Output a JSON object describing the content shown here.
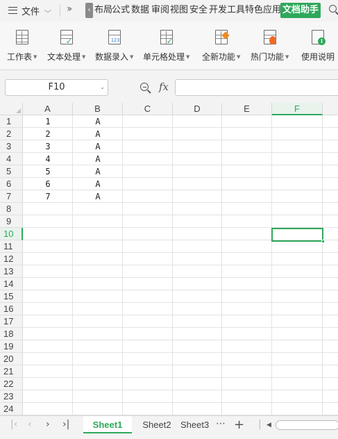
{
  "menubar": {
    "file_label": "文件",
    "tabs": [
      "布局",
      "公式",
      "数据",
      "审阅",
      "视图",
      "安全",
      "开发工具",
      "特色应用"
    ],
    "active_tab": "文档助手"
  },
  "ribbon": {
    "buttons": [
      {
        "label": "工作表",
        "icon": "worksheet-icon",
        "has_dropdown": true
      },
      {
        "label": "文本处理",
        "icon": "text-process-icon",
        "has_dropdown": true
      },
      {
        "label": "数据录入",
        "icon": "data-entry-icon",
        "has_dropdown": true
      },
      {
        "label": "单元格处理",
        "icon": "cell-process-icon",
        "has_dropdown": true
      },
      {
        "label": "全新功能",
        "icon": "new-feature-icon",
        "has_dropdown": true
      },
      {
        "label": "热门功能",
        "icon": "hot-feature-icon",
        "has_dropdown": true
      },
      {
        "label": "使用说明",
        "icon": "help-doc-icon",
        "has_dropdown": false
      }
    ]
  },
  "formula_bar": {
    "name_box": "F10",
    "fx_label": "fx",
    "formula": ""
  },
  "grid": {
    "columns": [
      "A",
      "B",
      "C",
      "D",
      "E",
      "F"
    ],
    "selected_column": "F",
    "rows": [
      "1",
      "2",
      "3",
      "4",
      "5",
      "6",
      "7",
      "8",
      "9",
      "10",
      "11",
      "12",
      "13",
      "14",
      "15",
      "16",
      "17",
      "18",
      "19",
      "20",
      "21",
      "22",
      "23",
      "24"
    ],
    "selected_row": "10",
    "cells": [
      {
        "row": 1,
        "A": "1",
        "B": "A"
      },
      {
        "row": 2,
        "A": "2",
        "B": "A"
      },
      {
        "row": 3,
        "A": "3",
        "B": "A"
      },
      {
        "row": 4,
        "A": "4",
        "B": "A"
      },
      {
        "row": 5,
        "A": "5",
        "B": "A"
      },
      {
        "row": 6,
        "A": "6",
        "B": "A"
      },
      {
        "row": 7,
        "A": "7",
        "B": "A"
      }
    ],
    "active_cell": "F10"
  },
  "sheets": {
    "tabs": [
      "Sheet1",
      "Sheet2",
      "Sheet3"
    ],
    "active": "Sheet1",
    "more": "⋯",
    "add": "+"
  },
  "colors": {
    "accent": "#2ea85a",
    "grid_line": "#e2e2e2",
    "header_bg": "#f3f3f3"
  }
}
